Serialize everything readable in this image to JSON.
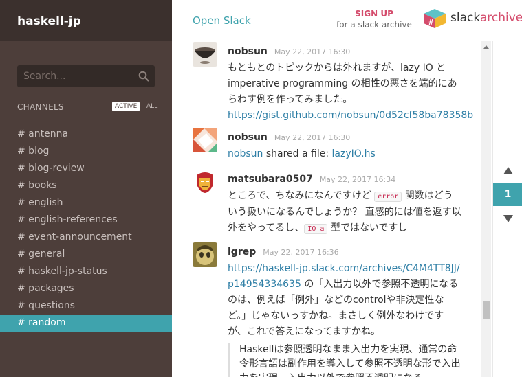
{
  "team": {
    "name": "haskell-jp"
  },
  "search": {
    "placeholder": "Search..."
  },
  "channels": {
    "title": "CHANNELS",
    "filter_active": "ACTIVE",
    "filter_all": "ALL",
    "items": [
      {
        "label": "# antenna"
      },
      {
        "label": "# blog"
      },
      {
        "label": "# blog-review"
      },
      {
        "label": "# books"
      },
      {
        "label": "# english"
      },
      {
        "label": "# english-references"
      },
      {
        "label": "# event-announcement"
      },
      {
        "label": "# general"
      },
      {
        "label": "# haskell-jp-status"
      },
      {
        "label": "# packages"
      },
      {
        "label": "# questions"
      },
      {
        "label": "# random",
        "selected": true
      }
    ]
  },
  "topbar": {
    "open_slack": "Open Slack",
    "signup_label": "SIGN UP",
    "signup_sub": "for a slack archive",
    "logo_text_a": "slack",
    "logo_text_b": "archive"
  },
  "messages": [
    {
      "user": "nobsun",
      "time": "May 22, 2017 16:30",
      "text": "もともとのトピックからは外れますが、lazy IO と imperative programming の相性の悪さを端的にあらわす例を作ってみました。",
      "link": "https://gist.github.com/nobsun/0d52cf58ba78358b"
    },
    {
      "user": "nobsun",
      "time": "May 22, 2017 16:30",
      "file_user": "nobsun",
      "file_action": " shared a file: ",
      "file_name": "lazyIO.hs"
    },
    {
      "user": "matsubara0507",
      "time": "May 22, 2017 16:34",
      "text_a": "ところで、ちなみになんですけど ",
      "code_a": "error",
      "text_b": " 関数はどういう扱いになるんでしょうか？ 直感的には値を返す以外をやってるし、",
      "code_b": "IO a",
      "text_c": " 型ではないですし"
    },
    {
      "user": "lgrep",
      "time": "May 22, 2017 16:36",
      "link": "https://haskell-jp.slack.com/archives/C4M4TT8JJ/p14954334635",
      "text": "の「入出力以外で参照不透明になるのは、例えば「例外」などのcontrolや非決定性など。」じゃないっすかね。まさしく例外なわけですが、これで答えになってますかね。",
      "quote": "Haskellは参照透明なまま入出力を実現、通常の命令形言語は副作用を導入して参照不透明な形で入出力を実現。入出力以外で参照不透明になる"
    }
  ],
  "pager": {
    "current": "1"
  },
  "colors": {
    "accent": "#3fa3ad",
    "sidebar": "#4d3e3a",
    "link": "#2f7fa6",
    "signup": "#d44c6c"
  }
}
